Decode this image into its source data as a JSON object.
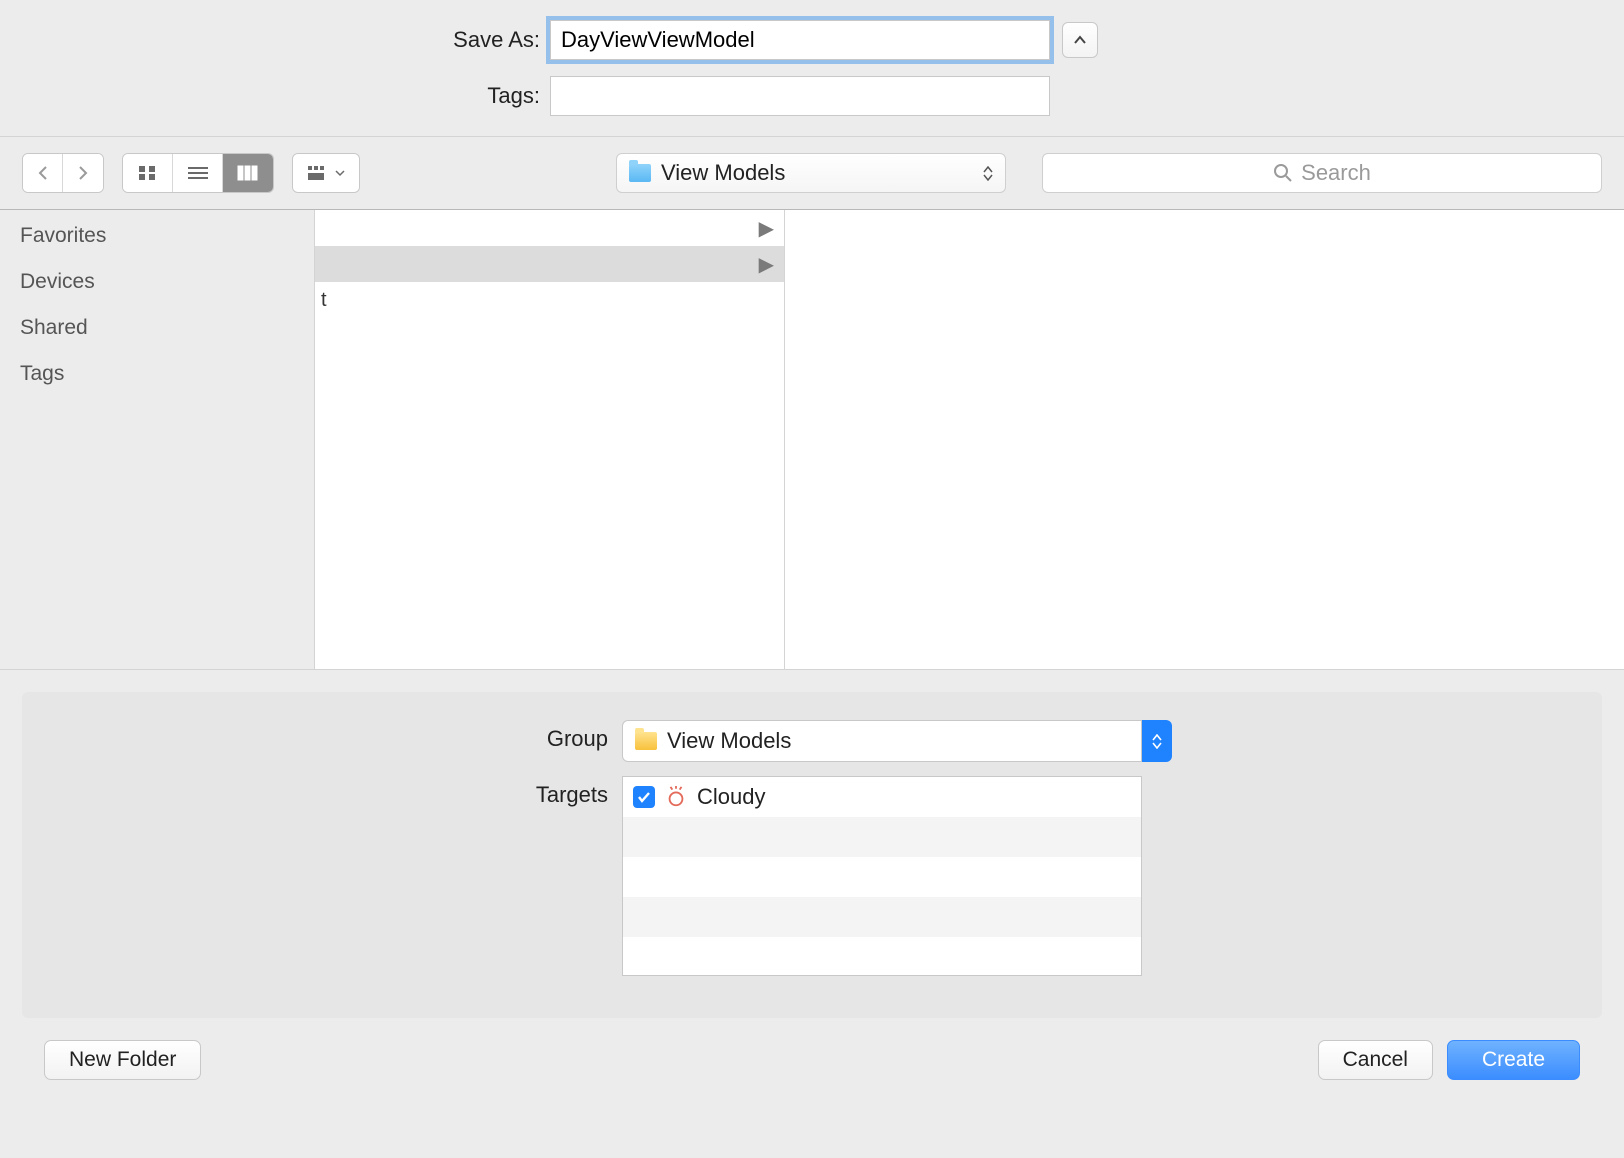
{
  "saveAs": {
    "label": "Save As:",
    "value": "DayViewViewModel"
  },
  "tags": {
    "label": "Tags:",
    "value": ""
  },
  "toolbar": {
    "location": "View Models",
    "searchPlaceholder": "Search"
  },
  "sidebar": {
    "items": [
      "Favorites",
      "Devices",
      "Shared",
      "Tags"
    ]
  },
  "column": {
    "rows": [
      {
        "text": "",
        "selected": false,
        "hasChild": true
      },
      {
        "text": "",
        "selected": true,
        "hasChild": true
      },
      {
        "text": "t",
        "selected": false,
        "hasChild": false
      }
    ]
  },
  "group": {
    "label": "Group",
    "value": "View Models"
  },
  "targets": {
    "label": "Targets",
    "items": [
      {
        "name": "Cloudy",
        "checked": true
      }
    ]
  },
  "footer": {
    "newFolder": "New Folder",
    "cancel": "Cancel",
    "create": "Create"
  }
}
